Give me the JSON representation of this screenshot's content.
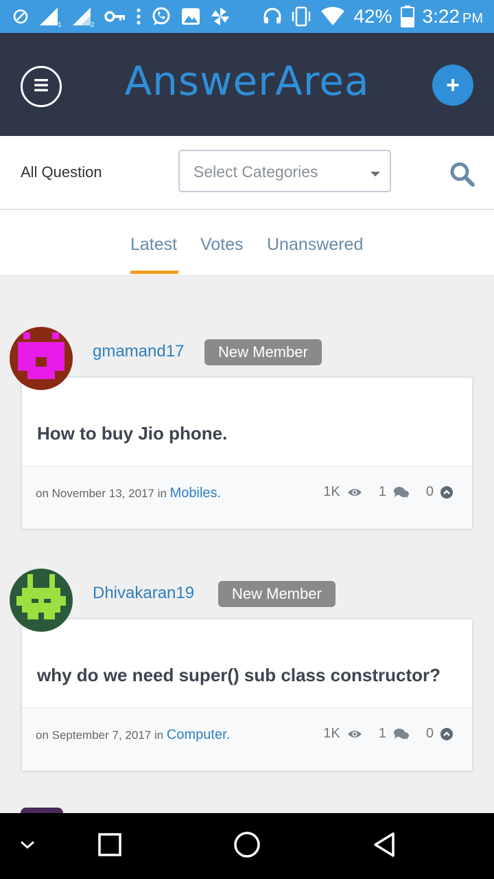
{
  "status_bar": {
    "battery": "42%",
    "time": "3:22",
    "period": "PM",
    "sim1": "1",
    "sim2": "2"
  },
  "header": {
    "logo": "AnswerArea",
    "add_label": "+"
  },
  "filter": {
    "all_question": "All Question",
    "select_placeholder": "Select Categories"
  },
  "tabs": [
    "Latest",
    "Votes",
    "Unanswered"
  ],
  "questions": [
    {
      "username": "gmamand17",
      "badge": "New Member",
      "title": "How to buy Jio phone.",
      "date": "on November 13, 2017 in",
      "category": "Mobiles.",
      "views": "1K",
      "answers": "1",
      "votes": "0",
      "avatar_bg": "#8b2a12",
      "avatar_fg": "#e81ce8"
    },
    {
      "username": "Dhivakaran19",
      "badge": "New Member",
      "title": "why do we need super() sub class constructor?",
      "date": "on September 7, 2017 in",
      "category": "Computer.",
      "views": "1K",
      "answers": "1",
      "votes": "0",
      "avatar_bg": "#2a5a3a",
      "avatar_fg": "#9ae040"
    }
  ],
  "colors": {
    "status_bar": "#3f9be0",
    "header": "#2e3648",
    "accent": "#2f8fd8",
    "tab_indicator": "#f0a020",
    "badge": "#8a8a8a"
  },
  "icons": {
    "status": [
      "blocked-icon",
      "signal-icon",
      "key-icon",
      "more-vert-icon",
      "whatsapp-icon",
      "image-icon",
      "pinwheel-icon",
      "headset-icon",
      "vibrate-icon",
      "wifi-icon",
      "battery-icon"
    ],
    "header": [
      "menu-icon",
      "plus-icon"
    ],
    "filter": [
      "search-icon",
      "caret-down-icon"
    ],
    "stats": [
      "eye-icon",
      "comments-icon",
      "chevron-up-circle-icon"
    ],
    "nav": [
      "chevron-down-icon",
      "square-icon",
      "circle-icon",
      "triangle-back-icon"
    ]
  }
}
